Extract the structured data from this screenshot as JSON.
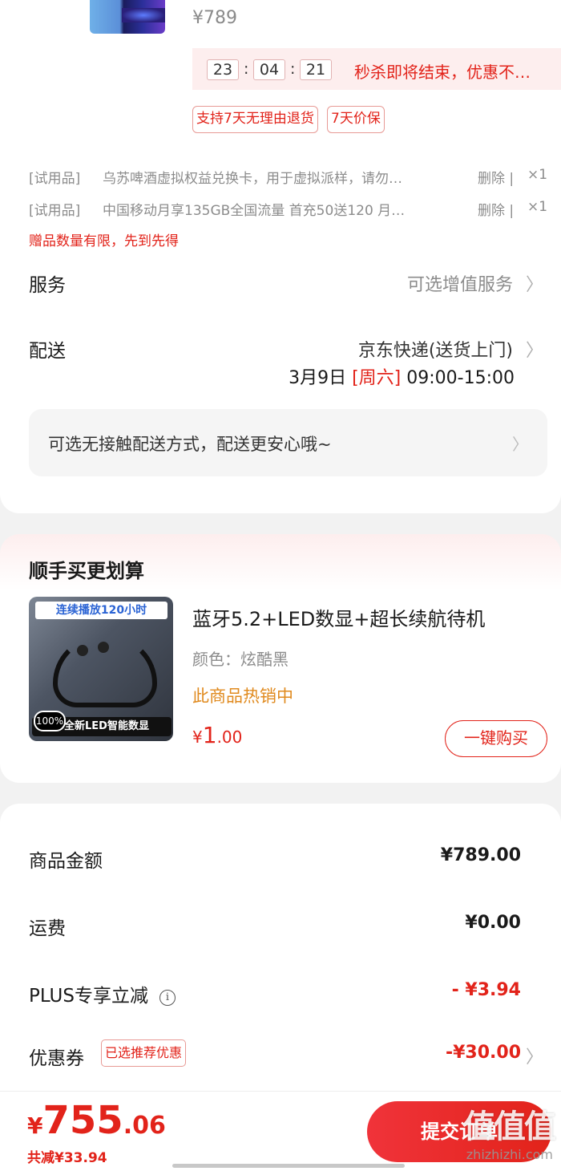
{
  "previous_item": {
    "price": "¥789"
  },
  "countdown": {
    "hours": "23",
    "minutes": "04",
    "seconds": "21",
    "sep": ":",
    "text": "秒杀即将结束，优惠不…"
  },
  "service_tags": [
    "支持7天无理由退货",
    "7天价保"
  ],
  "gifts": [
    {
      "tag": "[试用品]",
      "name": "乌苏啤酒虚拟权益兑换卡，用于虚拟派样，请勿…",
      "delete": "删除 |",
      "qty": "×1"
    },
    {
      "tag": "[试用品]",
      "name": "中国移动月享135GB全国流量 首充50送120 月…",
      "delete": "删除 |",
      "qty": "×1"
    }
  ],
  "gift_note": "赠品数量有限，先到先得",
  "service": {
    "label": "服务",
    "value": "可选增值服务"
  },
  "delivery": {
    "label": "配送",
    "value": "京东快递(送货上门)",
    "date": "3月9日",
    "weekday": "[周六]",
    "time": "09:00-15:00"
  },
  "contactless": {
    "text": "可选无接触配送方式，配送更安心哦~"
  },
  "chevron": "〉",
  "bundle": {
    "title": "顺手买更划算",
    "image_banner": "连续播放120小时",
    "image_caption": "全新LED智能数显",
    "image_pct": "100%",
    "product_title": "蓝牙5.2+LED数显+超长续航待机",
    "color": "颜色：炫酷黑",
    "hot": "此商品热销中",
    "price_currency": "¥",
    "price_int": "1",
    "price_dec": ".00",
    "buy_button": "一键购买"
  },
  "fees": {
    "goods": {
      "label": "商品金额",
      "value": "¥789.00"
    },
    "shipping": {
      "label": "运费",
      "value": "¥0.00"
    },
    "plus": {
      "label": "PLUS专享立减",
      "info": "i",
      "value": "- ¥3.94"
    },
    "coupon": {
      "label": "优惠券",
      "tag": "已选推荐优惠",
      "value": "-¥30.00"
    }
  },
  "footer": {
    "currency": "¥",
    "total_int": "755",
    "total_dec": ".06",
    "saved": "共减¥33.94",
    "submit": "提交订单",
    "watermark": "值值值",
    "watermark_url": "zhizhizhi.com"
  },
  "colors": {
    "accent": "#e2231a",
    "hot": "#e08a1e",
    "muted": "#8c8c8c"
  }
}
